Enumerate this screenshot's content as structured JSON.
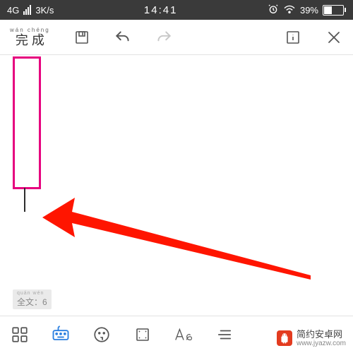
{
  "status": {
    "network": "4G",
    "speed": "3K/s",
    "time": "14:41",
    "battery_percent": "39%"
  },
  "toolbar": {
    "done_pinyin": "wán  chéng",
    "done_label": "完 成"
  },
  "editor": {
    "word_count_pinyin": "quán  wén",
    "word_count_label": "全文：6"
  },
  "watermark": {
    "title": "简约安卓网",
    "url": "www.jyazw.com"
  }
}
